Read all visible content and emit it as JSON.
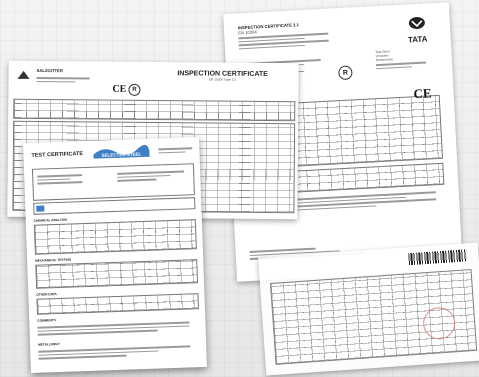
{
  "back_right_doc": {
    "header_lines": [
      "INSPECTION CERTIFICATE 3.1",
      "EN 10204"
    ],
    "brand_name": "TATA",
    "brand_lines": [
      "Tata Steel",
      "IJmuiden",
      "Netherlands"
    ],
    "mark": "R",
    "ce_mark": "CE"
  },
  "back_left_doc": {
    "company": "SALZGITTER",
    "title": "INSPECTION CERTIFICATE",
    "subtitle": "EN 10204 Type 3.1",
    "ce_mark": "CE",
    "mark": "R"
  },
  "front_doc": {
    "title": "TEST CERTIFICATE",
    "logo_text": "SELECTED STEEL",
    "sections": [
      "CHEMICAL ANALYSIS",
      "MECHANICAL TESTING",
      "OTHER DATA",
      "COMMENTS",
      "METALLURGY"
    ]
  },
  "colors": {
    "logo_blue": "#3f7fc4",
    "stamp": "#d88"
  }
}
